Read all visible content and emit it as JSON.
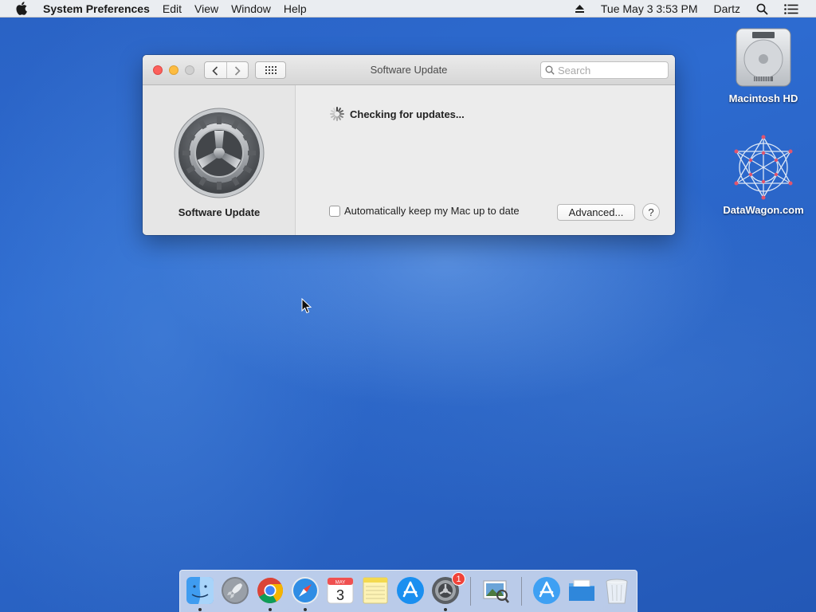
{
  "menubar": {
    "app_name": "System Preferences",
    "menus": [
      "Edit",
      "View",
      "Window",
      "Help"
    ],
    "datetime": "Tue May 3  3:53 PM",
    "user": "Dartz"
  },
  "window": {
    "title": "Software Update",
    "search_placeholder": "Search",
    "pane_label": "Software Update",
    "status_text": "Checking for updates...",
    "auto_update_label": "Automatically keep my Mac up to date",
    "auto_update_checked": false,
    "advanced_label": "Advanced...",
    "help_label": "?"
  },
  "desktop": {
    "icons": [
      {
        "label": "Macintosh HD",
        "icon": "hard-drive-icon"
      },
      {
        "label": "DataWagon.com",
        "icon": "datawagon-logo-icon"
      }
    ]
  },
  "dock": {
    "items": [
      {
        "name": "Finder",
        "icon": "finder-icon",
        "running": true
      },
      {
        "name": "Launchpad",
        "icon": "launchpad-icon",
        "running": false
      },
      {
        "name": "Google Chrome",
        "icon": "chrome-icon",
        "running": true
      },
      {
        "name": "Safari",
        "icon": "safari-icon",
        "running": true
      },
      {
        "name": "Calendar",
        "icon": "calendar-icon",
        "running": false,
        "month": "MAY",
        "day": "3"
      },
      {
        "name": "Notes",
        "icon": "notes-icon",
        "running": false
      },
      {
        "name": "App Store",
        "icon": "app-store-icon",
        "running": false
      },
      {
        "name": "System Preferences",
        "icon": "system-preferences-icon",
        "running": true,
        "badge": "1"
      },
      {
        "name": "Preview",
        "icon": "preview-icon",
        "running": false
      },
      {
        "name": "Applications",
        "icon": "applications-folder-icon",
        "running": false
      },
      {
        "name": "Documents",
        "icon": "documents-folder-icon",
        "running": false
      },
      {
        "name": "Trash",
        "icon": "trash-icon",
        "running": false
      }
    ]
  },
  "colors": {
    "desktop": "#2a64c6",
    "close": "#fc605c",
    "minimize": "#fdbc40",
    "badge": "#f0433a"
  }
}
